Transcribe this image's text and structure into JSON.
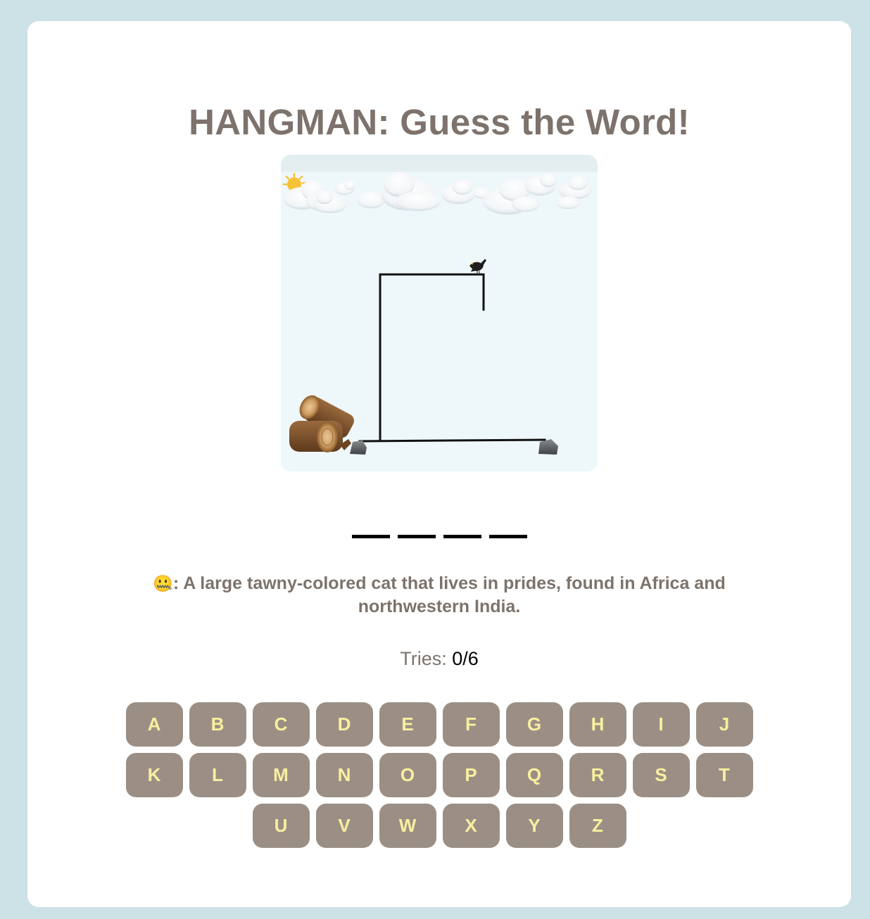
{
  "game": {
    "title": "HANGMAN: Guess the Word!",
    "word_slots": [
      "",
      "",
      "",
      ""
    ],
    "hint_emoji": "🤐",
    "hint_text": ": A large tawny-colored cat that lives in prides, found in Africa and northwestern India.",
    "tries_label": "Tries: ",
    "tries_value": "0/6"
  },
  "scene": {
    "icons": [
      "sun-icon",
      "cloud-icon",
      "bird-icon",
      "logs-icon",
      "rock-icon"
    ],
    "colors": {
      "sky": "#eef7f9",
      "gallows": "#111111"
    }
  },
  "keyboard": {
    "rows": [
      [
        "A",
        "B",
        "C",
        "D",
        "E",
        "F",
        "G",
        "H",
        "I",
        "J"
      ],
      [
        "K",
        "L",
        "M",
        "N",
        "O",
        "P",
        "Q",
        "R",
        "S",
        "T"
      ],
      [
        "U",
        "V",
        "W",
        "X",
        "Y",
        "Z"
      ]
    ],
    "colors": {
      "key_bg": "#9b8f85",
      "key_text": "#f7ef9f"
    }
  },
  "colors": {
    "page_bg": "#cde2e6",
    "card_bg": "#ffffff",
    "title": "#7d736c"
  }
}
